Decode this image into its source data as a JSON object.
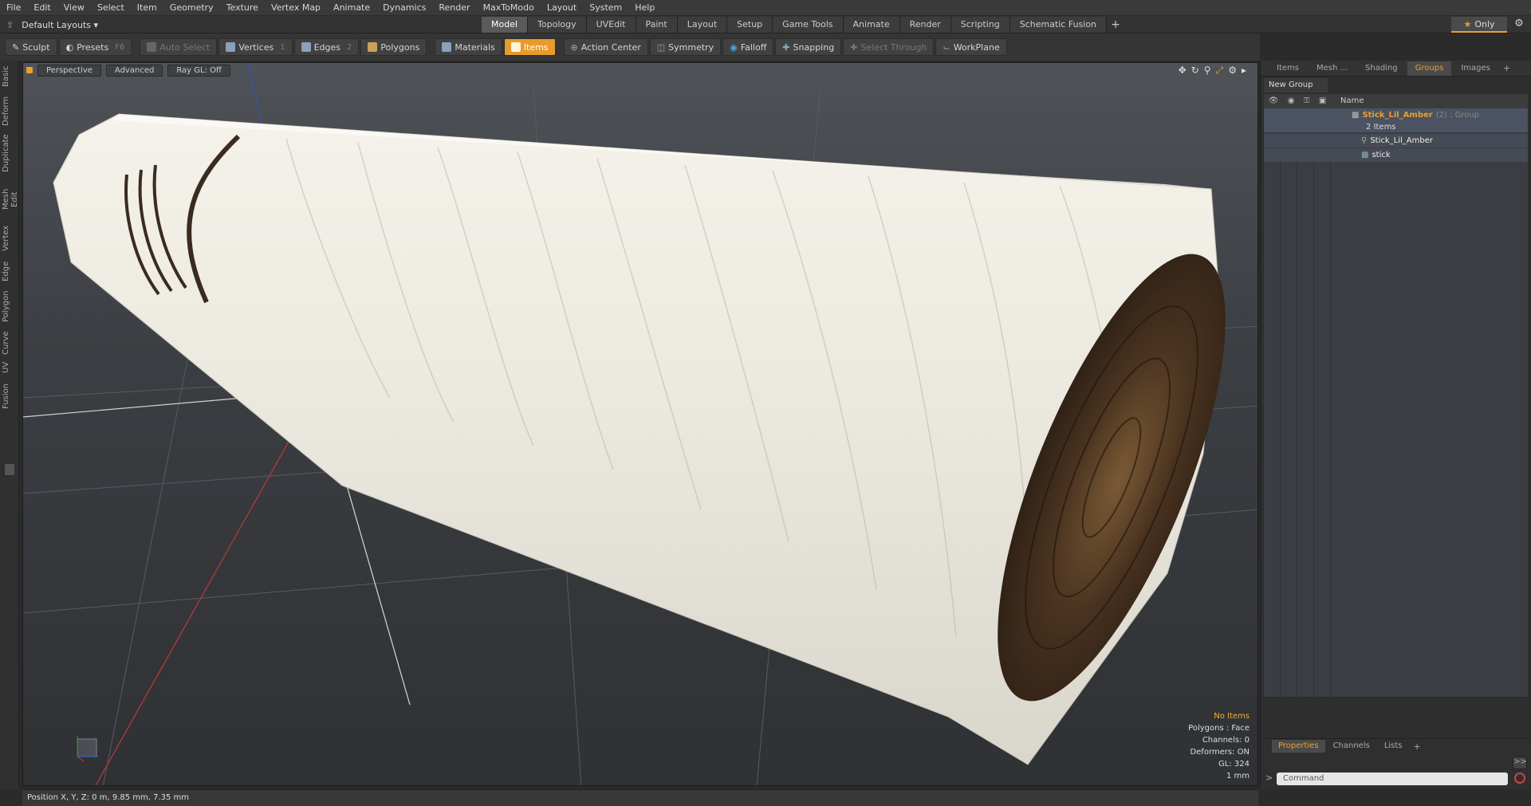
{
  "menu": [
    "File",
    "Edit",
    "View",
    "Select",
    "Item",
    "Geometry",
    "Texture",
    "Vertex Map",
    "Animate",
    "Dynamics",
    "Render",
    "MaxToModo",
    "Layout",
    "System",
    "Help"
  ],
  "layout_selector": "Default Layouts ▾",
  "mode_tabs": [
    {
      "label": "Model",
      "active": true
    },
    {
      "label": "Topology"
    },
    {
      "label": "UVEdit"
    },
    {
      "label": "Paint"
    },
    {
      "label": "Layout"
    },
    {
      "label": "Setup"
    },
    {
      "label": "Game Tools"
    },
    {
      "label": "Animate"
    },
    {
      "label": "Render"
    },
    {
      "label": "Scripting"
    },
    {
      "label": "Schematic Fusion"
    }
  ],
  "add_tab": "+",
  "only_label": "Only",
  "toolbar": {
    "sculpt": "Sculpt",
    "presets": "Presets",
    "presets_key": "F6",
    "auto_select": "Auto Select",
    "vertices": "Vertices",
    "vertices_key": "1",
    "edges": "Edges",
    "edges_key": "2",
    "polygons": "Polygons",
    "materials": "Materials",
    "items": "Items",
    "action_center": "Action Center",
    "symmetry": "Symmetry",
    "falloff": "Falloff",
    "snapping": "Snapping",
    "select_through": "Select Through",
    "workplane": "WorkPlane"
  },
  "left_tabs": [
    "Basic",
    "Deform",
    "Duplicate",
    "Mesh Edit",
    "Vertex",
    "Edge",
    "Polygon",
    "Curve",
    "UV",
    "Fusion"
  ],
  "viewport": {
    "view": "Perspective",
    "advanced": "Advanced",
    "raygl": "Ray GL: Off",
    "info": {
      "no_items": "No Items",
      "polygons": "Polygons : Face",
      "channels": "Channels: 0",
      "deformers": "Deformers: ON",
      "gl": "GL: 324",
      "units": "1 mm"
    }
  },
  "right_panel": {
    "tabs": [
      "Items",
      "Mesh ...",
      "Shading",
      "Groups",
      "Images"
    ],
    "active_tab": "Groups",
    "new_group": "New Group",
    "name_header": "Name",
    "group_name": "Stick_Lil_Amber",
    "group_suffix": "(2) : Group",
    "group_count": "2 Items",
    "children": [
      "Stick_Lil_Amber",
      "stick"
    ],
    "bottom_tabs": [
      "Properties",
      "Channels",
      "Lists"
    ],
    "bottom_active": "Properties",
    "command_placeholder": "Command"
  },
  "statusbar": "Position X, Y, Z:  0 m, 9.85 mm, 7.35 mm",
  "colors": {
    "accent": "#e89b2a",
    "bg": "#2b2b2b"
  }
}
